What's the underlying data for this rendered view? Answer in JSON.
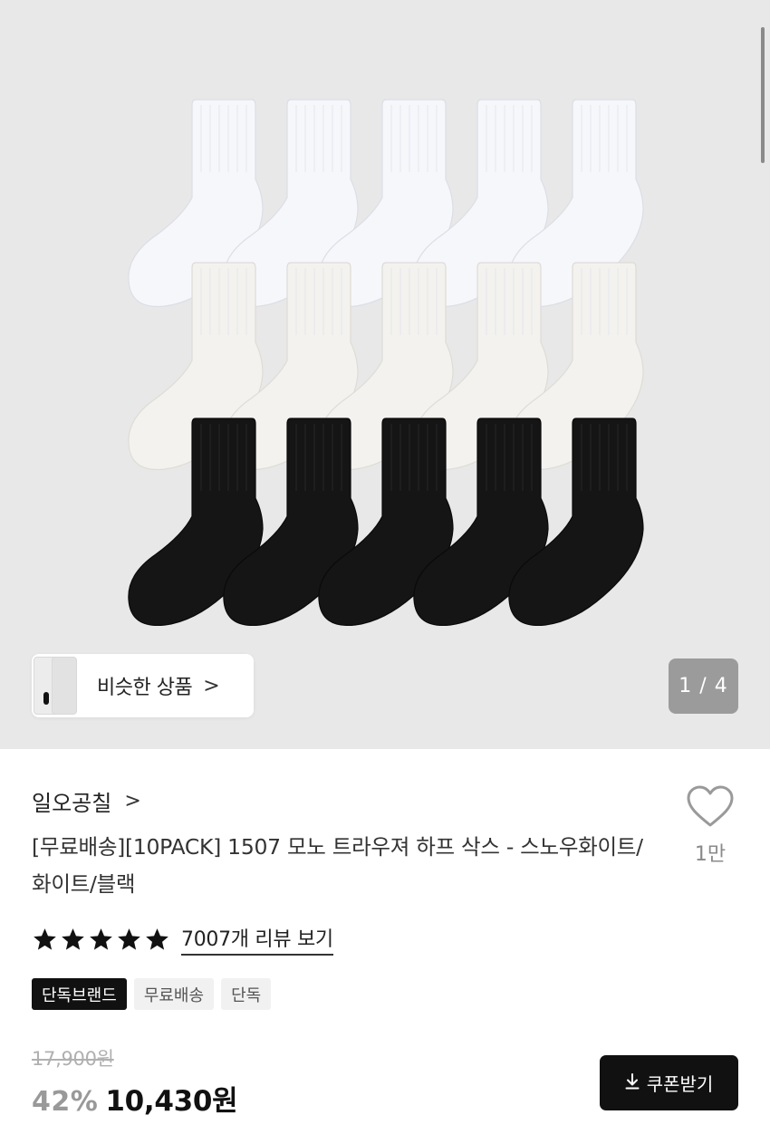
{
  "gallery": {
    "similar_label": "비슷한 상품",
    "chevron": ">",
    "image_counter": "1 / 4",
    "sock_rows": [
      {
        "color": "#f6f7fb",
        "outline": "#dcdee6"
      },
      {
        "color": "#f3f2ee",
        "outline": "#dedcd6"
      },
      {
        "color": "#151515",
        "outline": "#0a0a0a"
      }
    ]
  },
  "product": {
    "brand": "일오공칠",
    "brand_chevron": ">",
    "title": "[무료배송][10PACK] 1507 모노 트라우져 하프 삭스 - 스노우화이트/화이트/블랙",
    "wishlist_count": "1만",
    "rating_stars": 5,
    "review_link": "7007개 리뷰 보기",
    "tags": [
      "단독브랜드",
      "무료배송",
      "단독"
    ],
    "original_price": "17,900원",
    "discount_rate": "42%",
    "final_price": "10,430원",
    "coupon_button": "쿠폰받기"
  },
  "colors": {
    "gallery_bg": "#e8e8e8",
    "primary_button": "#111111",
    "counter_bg": "#9b9b9b"
  }
}
